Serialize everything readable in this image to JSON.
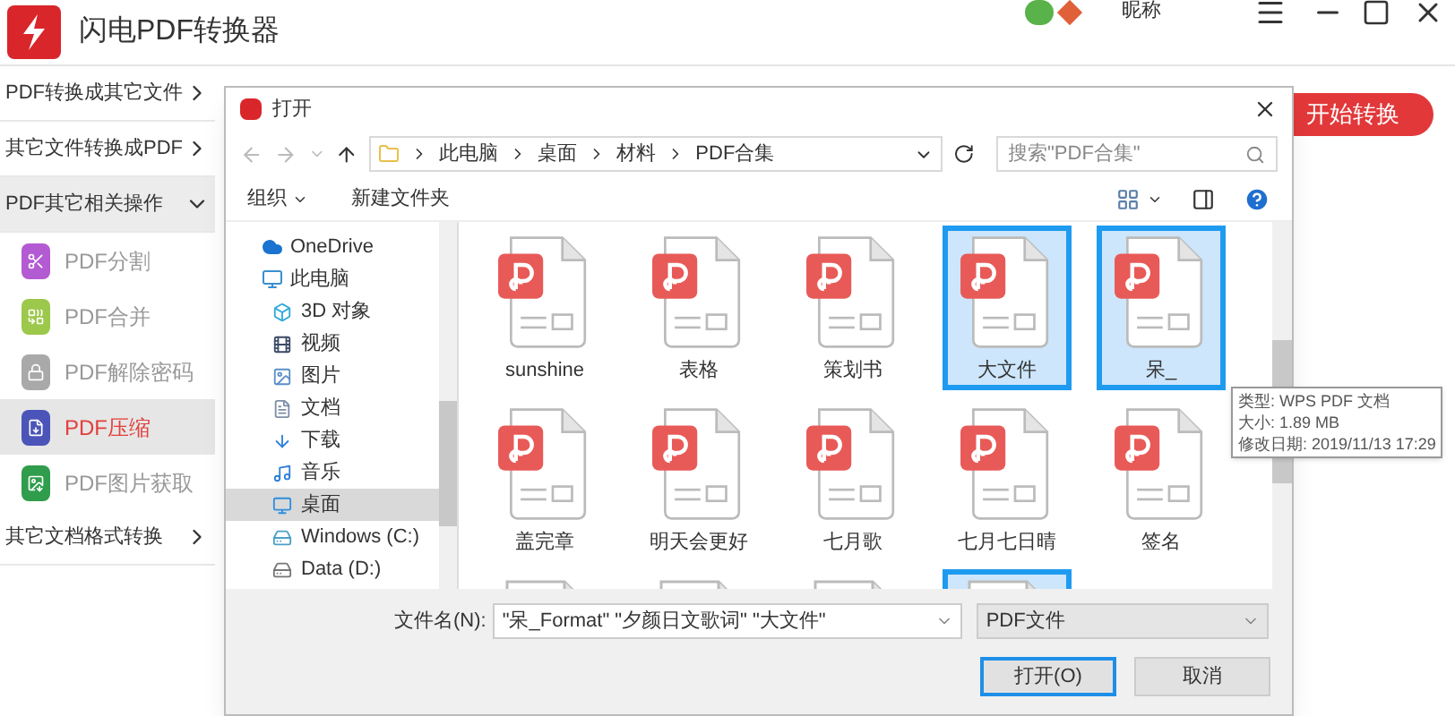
{
  "app": {
    "title": "闪电PDF转换器",
    "user": "昵称"
  },
  "sidebar": [
    {
      "label": "PDF转换成其它文件",
      "expanded": false
    },
    {
      "label": "其它文件转换成PDF",
      "expanded": false
    },
    {
      "label": "PDF其它相关操作",
      "expanded": true,
      "children": [
        {
          "label": "PDF分割",
          "selected": false,
          "color": "#b35bd3"
        },
        {
          "label": "PDF合并",
          "selected": false,
          "color": "#9cc84b"
        },
        {
          "label": "PDF解除密码",
          "selected": false,
          "color": "#a9a9a9"
        },
        {
          "label": "PDF压缩",
          "selected": true,
          "color": "#4b54b8"
        },
        {
          "label": "PDF图片获取",
          "selected": false,
          "color": "#2f9d4c"
        }
      ]
    },
    {
      "label": "其它文档格式转换",
      "expanded": false
    }
  ],
  "start_button": "开始转换",
  "dialog": {
    "title": "打开",
    "breadcrumb": [
      "此电脑",
      "桌面",
      "材料",
      "PDF合集"
    ],
    "search": {
      "placeholder": "搜索\"PDF合集\""
    },
    "toolbar": [
      "组织",
      "新建文件夹"
    ],
    "nav": [
      {
        "label": "OneDrive",
        "selected": false
      },
      {
        "label": "此电脑",
        "selected": false,
        "children": [
          {
            "label": "3D 对象",
            "selected": false
          },
          {
            "label": "视频",
            "selected": false
          },
          {
            "label": "图片",
            "selected": false
          },
          {
            "label": "文档",
            "selected": false
          },
          {
            "label": "下载",
            "selected": false
          },
          {
            "label": "音乐",
            "selected": false
          },
          {
            "label": "桌面",
            "selected": true
          },
          {
            "label": "Windows (C:)",
            "selected": false
          },
          {
            "label": "Data (D:)",
            "selected": false
          }
        ]
      }
    ],
    "files": [
      {
        "name": "sunshine",
        "selected": false
      },
      {
        "name": "表格",
        "selected": false
      },
      {
        "name": "策划书",
        "selected": false
      },
      {
        "name": "大文件",
        "selected": true
      },
      {
        "name": "呆_",
        "selected": true
      },
      {
        "name": "盖完章",
        "selected": false
      },
      {
        "name": "明天会更好",
        "selected": false
      },
      {
        "name": "七月歌",
        "selected": false
      },
      {
        "name": "七月七日晴",
        "selected": false
      },
      {
        "name": "签名",
        "selected": false
      },
      {
        "selected": false
      },
      {
        "selected": false
      },
      {
        "selected": false
      },
      {
        "selected": true
      }
    ],
    "tooltip": [
      "类型: WPS PDF 文档",
      "大小: 1.89 MB",
      "修改日期: 2019/11/13 17:29"
    ],
    "filename_label": "文件名(N):",
    "filename": "\"呆_Format\" \"夕颜日文歌词\" \"大文件\"",
    "filter": "PDF文件",
    "buttons": [
      {
        "label": "打开(O)",
        "kind": "primary"
      },
      {
        "label": "取消",
        "kind": "secondary"
      }
    ]
  }
}
